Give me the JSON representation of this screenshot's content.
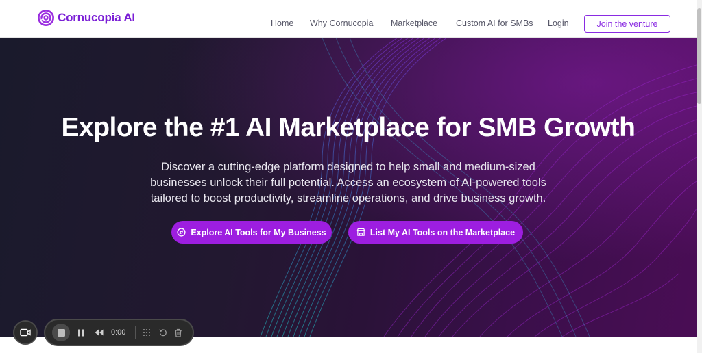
{
  "brand": {
    "name": "Cornucopia AI",
    "color": "#7b1fd6"
  },
  "nav": {
    "links": [
      "Home",
      "Why Cornucopia",
      "Marketplace",
      "Custom AI for SMBs",
      "Login"
    ],
    "cta": "Join the venture"
  },
  "hero": {
    "title": "Explore the #1 AI Marketplace for SMB Growth",
    "description_lines": [
      "Discover a cutting-edge platform designed to help small and medium-sized",
      "businesses unlock their full potential. Access an ecosystem of AI-powered tools",
      "tailored to boost productivity, streamline operations, and drive business growth."
    ],
    "buttons": {
      "explore": "Explore AI Tools for My Business",
      "list": "List My AI Tools on the Marketplace"
    },
    "accent_color": "#9d1ee0"
  },
  "recorder": {
    "time": "0:00",
    "icons": [
      "camera-icon",
      "stop-icon",
      "pause-icon",
      "rewind-icon",
      "grid-icon",
      "restart-icon",
      "trash-icon"
    ]
  }
}
